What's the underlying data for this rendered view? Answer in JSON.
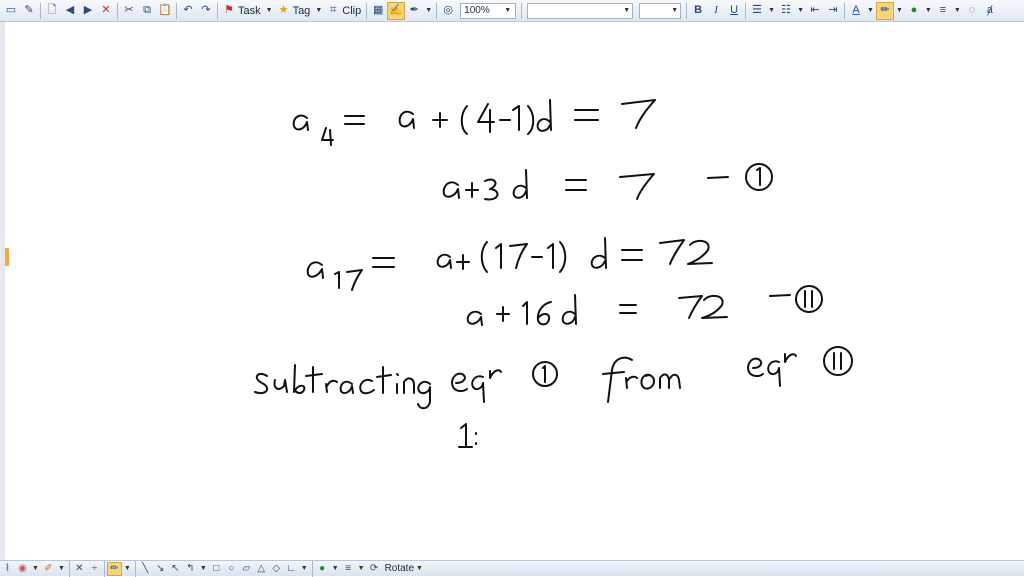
{
  "toolbar": {
    "task_label": "Task",
    "tag_label": "Tag",
    "clip_label": "Clip",
    "zoom_value": "100%",
    "bold_label": "B",
    "italic_label": "I",
    "underline_label": "U",
    "font_color_label": "A"
  },
  "bottombar": {
    "rotate_label": "Rotate"
  },
  "colors": {
    "ink": "#111111",
    "toolbar_bg": "#dfe7f2",
    "highlight": "#f6d47a",
    "accent_orange": "#f1a94a"
  }
}
